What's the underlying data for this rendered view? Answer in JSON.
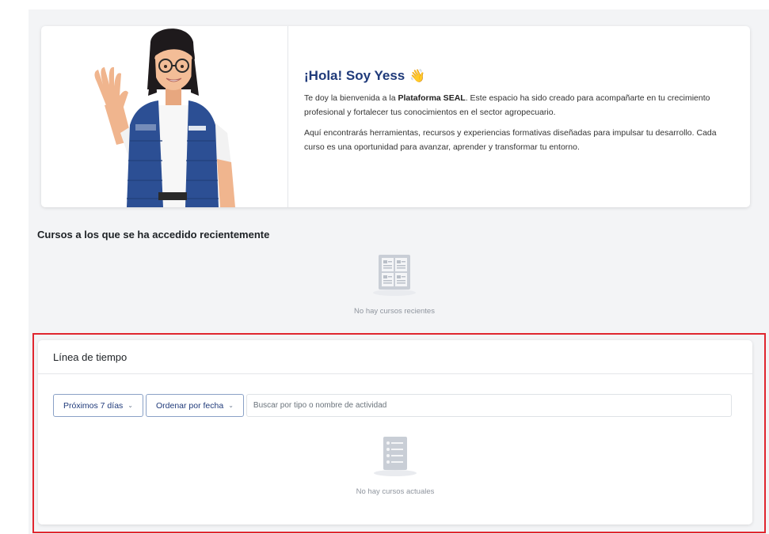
{
  "welcome": {
    "title": "¡Hola! Soy Yess",
    "title_emoji": "👋",
    "intro_before": "Te doy la bienvenida a la ",
    "platform_name": "Plataforma SEAL",
    "intro_after": ". Este espacio ha sido creado para acompañarte en tu crecimiento profesional y fortalecer tus conocimientos en el sector agropecuario.",
    "paragraph2": "Aquí encontrarás herramientas, recursos y experiencias formativas diseñadas para impulsar tu desarrollo. Cada curso es una oportunidad para avanzar, aprender y transformar tu entorno.",
    "avatar_icon": "woman-waving-avatar"
  },
  "recent": {
    "title": "Cursos a los que se ha accedido recientemente",
    "empty_text": "No hay cursos recientes",
    "empty_icon": "course-grid-icon"
  },
  "timeline": {
    "title": "Línea de tiempo",
    "filter_label": "Próximos 7 días",
    "sort_label": "Ordenar por fecha",
    "search_placeholder": "Buscar por tipo o nombre de actividad",
    "empty_text": "No hay cursos actuales",
    "empty_icon": "activity-list-icon"
  },
  "colors": {
    "accent": "#1f3a7a",
    "highlight": "#e0262f",
    "vest": "#2c4f94"
  }
}
